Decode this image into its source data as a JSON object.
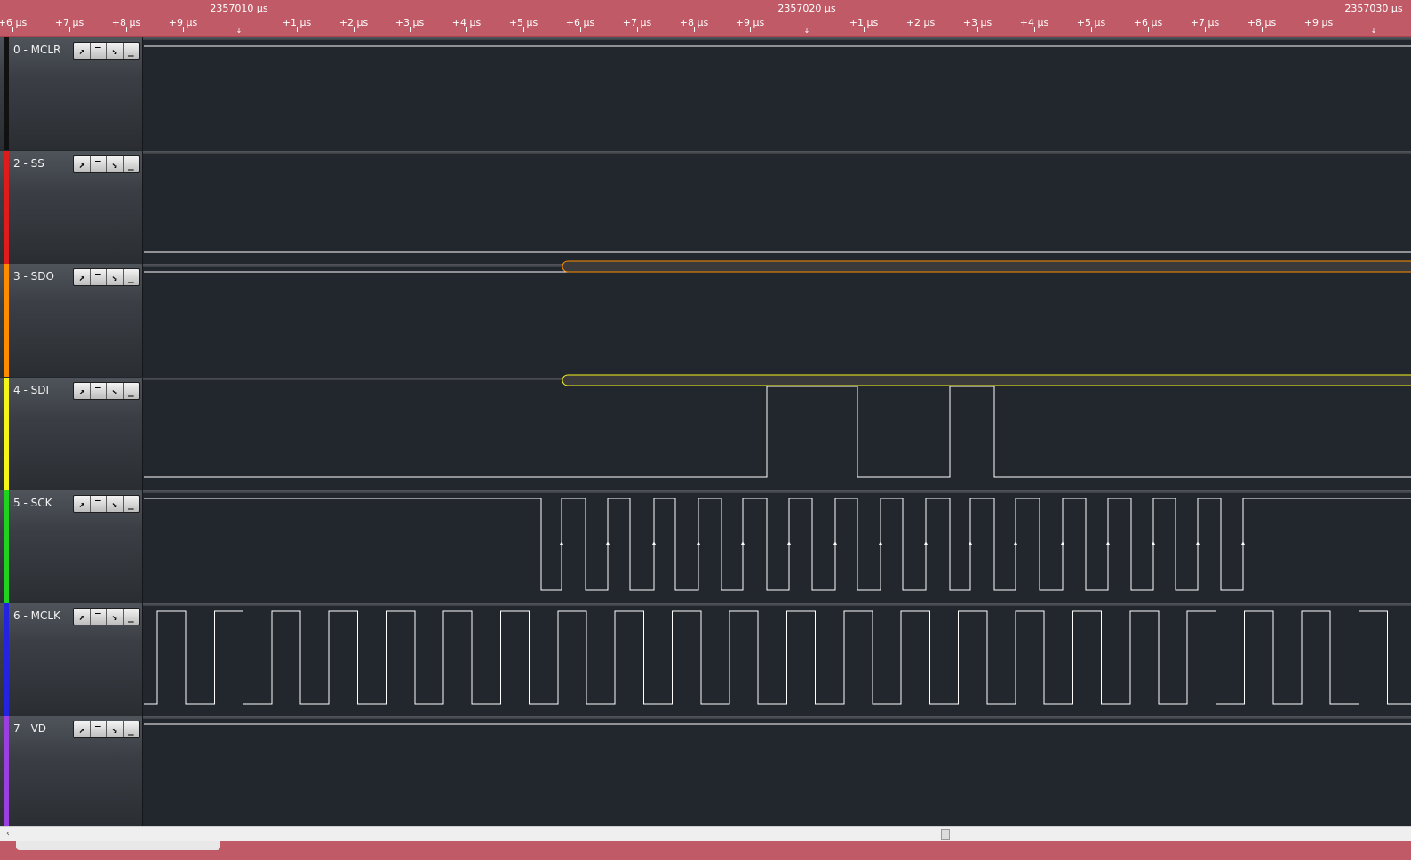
{
  "ruler": {
    "minor_ticks": [
      "+6 µs",
      "+7 µs",
      "+8 µs",
      "+9 µs",
      "+1 µs",
      "+2 µs",
      "+3 µs",
      "+4 µs",
      "+5 µs",
      "+6 µs",
      "+7 µs",
      "+8 µs",
      "+9 µs",
      "+1 µs",
      "+2 µs",
      "+3 µs",
      "+4 µs",
      "+5 µs",
      "+6 µs",
      "+7 µs",
      "+8 µs",
      "+9 µs"
    ],
    "major_ticks": [
      "2357010 µs",
      "2357020 µs",
      "2357030 µs"
    ]
  },
  "button_glyphs": [
    "↗",
    "‾",
    "↘",
    "_"
  ],
  "channels": [
    {
      "label": "0 - MCLR",
      "color": "#111111"
    },
    {
      "label": "2 - SS",
      "color": "#e01b1b"
    },
    {
      "label": "3 - SDO",
      "color": "#ff8c00"
    },
    {
      "label": "4 - SDI",
      "color": "#f5f51b"
    },
    {
      "label": "5 - SCK",
      "color": "#1fd31f"
    },
    {
      "label": "6 - MCLK",
      "color": "#2323e0"
    },
    {
      "label": "7 - VD",
      "color": "#9b3fe0"
    }
  ],
  "colors": {
    "ruler_bg": "#c05a66",
    "waveform": "#ffffff",
    "channel_bg": "#22262d",
    "sdo_bus": "#ff8c00",
    "sdi_bus": "#f5f51b"
  }
}
